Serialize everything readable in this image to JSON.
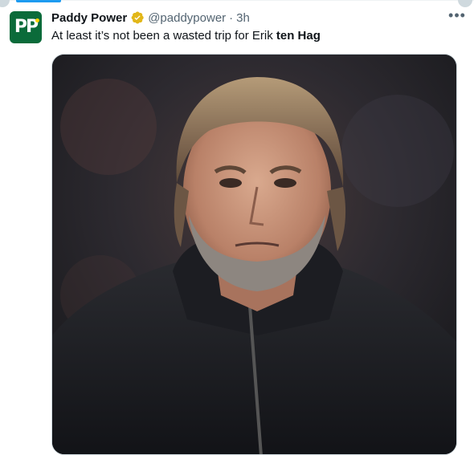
{
  "tweet": {
    "author": {
      "display_name": "Paddy Power",
      "handle": "@paddypower",
      "avatar_text": "PP",
      "verified_badge": "gold-verified-icon"
    },
    "separator": "·",
    "time": "3h",
    "more_label": "•••",
    "text_before": "At least it’s not been a wasted trip for Erik ",
    "text_bold": "ten Hag",
    "media": {
      "type": "photo",
      "icon": "photo"
    }
  },
  "colors": {
    "text_primary": "#0f1419",
    "text_secondary": "#536471",
    "accent": "#1d9bf0",
    "verified_gold": "#e2b719",
    "avatar_green": "#0b6b3a"
  }
}
